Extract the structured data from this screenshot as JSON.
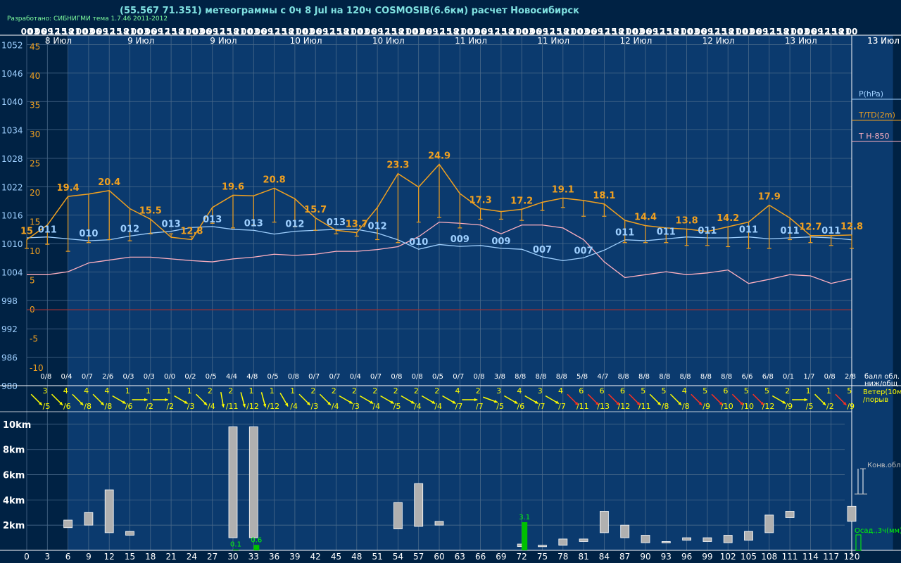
{
  "title": "(55.567 71.351) метеограммы с  0ч 8 Jul на 120ч COSMOSIB(6.6км) расчет Новосибирск",
  "credit": "Разработано: СИБНИГМИ тема 1.7.46 2011-2012",
  "colors": {
    "background": "#002244",
    "band": "#0b3a6e",
    "grid": "#4a6a8a",
    "pressure": "#9fd0ff",
    "temperature": "#f0a020",
    "t850": "#ffb0c0",
    "zero_line": "#a03030",
    "wind_yellow": "#ffff00",
    "wind_red": "#ff3020",
    "cloud_bar": "#b0b0b0",
    "precip": "#00c000",
    "labels": "#ffffff"
  },
  "chart_data": [
    {
      "type": "line",
      "name": "meteogram-upper",
      "top_hours": [
        "00",
        "03",
        "06",
        "09",
        "12",
        "15",
        "18",
        "21",
        "00",
        "03",
        "06",
        "09",
        "12",
        "15",
        "18",
        "21",
        "00",
        "03",
        "06",
        "09",
        "12",
        "15",
        "18",
        "21",
        "00",
        "03",
        "06",
        "09",
        "12",
        "15",
        "18",
        "21",
        "00",
        "03",
        "06",
        "09",
        "12",
        "15",
        "18",
        "21",
        "00",
        "03",
        "06",
        "09",
        "12",
        "15",
        "18",
        "21",
        "00",
        "03",
        "06",
        "09",
        "12",
        "15",
        "18",
        "21",
        "00",
        "03",
        "06",
        "09",
        "12",
        "15",
        "18",
        "21",
        "00",
        "03",
        "06",
        "09",
        "12",
        "15",
        "18",
        "21",
        "00",
        "03",
        "06",
        "09",
        "12",
        "15",
        "18",
        "21",
        "00",
        "03",
        "06",
        "09",
        "12",
        "15",
        "18",
        "21",
        "00",
        "03",
        "06",
        "09",
        "12",
        "15",
        "18",
        "21",
        "00",
        "03",
        "06",
        "09",
        "12",
        "15",
        "18",
        "21",
        "00",
        "03",
        "06",
        "09",
        "12",
        "15",
        "18",
        "21",
        "00",
        "03",
        "06",
        "09",
        "12",
        "15",
        "18",
        "21",
        "00"
      ],
      "date_labels": [
        {
          "h": 0,
          "t": "8 Июл"
        },
        {
          "h": 12,
          "t": "9 Июл"
        },
        {
          "h": 24,
          "t": "9 Июл"
        },
        {
          "h": 36,
          "t": "10 Июл"
        },
        {
          "h": 48,
          "t": "10 Июл"
        },
        {
          "h": 60,
          "t": "11 Июл"
        },
        {
          "h": 72,
          "t": "11 Июл"
        },
        {
          "h": 84,
          "t": "12 Июл"
        },
        {
          "h": 96,
          "t": "12 Июл"
        },
        {
          "h": 108,
          "t": "13 Июл"
        },
        {
          "h": 120,
          "t": "13 Июл"
        }
      ],
      "pressure_axis": {
        "label": "P(hPa)",
        "ticks": [
          1052,
          1046,
          1040,
          1034,
          1028,
          1022,
          1016,
          1010,
          1004,
          998,
          992,
          986,
          980
        ],
        "range": [
          980,
          1054
        ]
      },
      "temperature_axis": {
        "label": "T/TD(2m)",
        "ticks": [
          45,
          40,
          35,
          30,
          25,
          20,
          15,
          10,
          5,
          0,
          -5,
          -10
        ],
        "range": [
          -13,
          47
        ]
      },
      "t850_label": "T H-850",
      "x": [
        0,
        3,
        6,
        9,
        12,
        15,
        18,
        21,
        24,
        27,
        30,
        33,
        36,
        39,
        42,
        45,
        48,
        51,
        54,
        57,
        60,
        63,
        66,
        69,
        72,
        75,
        78,
        81,
        84,
        87,
        90,
        93,
        96,
        99,
        102,
        105,
        108,
        111,
        114,
        117,
        120
      ],
      "series": [
        {
          "name": "P(hPa)",
          "values": [
            1011.2,
            1011.4,
            1011.0,
            1010.6,
            1010.8,
            1011.6,
            1012.2,
            1012.6,
            1013.4,
            1013.6,
            1013.0,
            1012.8,
            1012.0,
            1012.6,
            1012.8,
            1013.0,
            1013.0,
            1012.2,
            1010.8,
            1008.8,
            1009.8,
            1009.4,
            1009.6,
            1009.0,
            1008.8,
            1007.2,
            1006.4,
            1007.0,
            1008.6,
            1010.8,
            1010.6,
            1011.0,
            1011.4,
            1011.2,
            1011.2,
            1011.4,
            1011.0,
            1011.2,
            1011.4,
            1011.2,
            1010.8
          ]
        },
        {
          "name": "T(2m)",
          "values": [
            12.0,
            14.5,
            19.4,
            19.8,
            20.4,
            17.3,
            15.5,
            12.4,
            12.0,
            17.5,
            19.6,
            19.5,
            20.8,
            19.0,
            15.7,
            13.6,
            13.2,
            17.5,
            23.3,
            21.0,
            24.9,
            19.9,
            17.3,
            16.8,
            17.2,
            18.4,
            19.1,
            18.7,
            18.1,
            15.3,
            14.4,
            14.0,
            13.8,
            13.4,
            14.2,
            15.0,
            17.9,
            15.7,
            12.7,
            12.7,
            12.8
          ]
        },
        {
          "name": "TD(2m)",
          "values": [
            10.5,
            11.2,
            10.0,
            11.5,
            12.0,
            11.8,
            13.0,
            13.0,
            12.5,
            14.8,
            14.0,
            14.5,
            15.0,
            14.2,
            13.6,
            13.0,
            12.6,
            12.0,
            11.5,
            15.0,
            15.8,
            14.0,
            15.5,
            15.5,
            15.3,
            17.0,
            17.5,
            16.0,
            16.0,
            11.5,
            11.5,
            11.5,
            11.0,
            11.0,
            10.8,
            10.5,
            10.5,
            12.0,
            11.5,
            11.0,
            10.5
          ]
        },
        {
          "name": "T H-850",
          "values": [
            6.0,
            6.0,
            6.5,
            8.0,
            8.5,
            9.0,
            9.0,
            8.7,
            8.4,
            8.2,
            8.7,
            9.0,
            9.5,
            9.3,
            9.5,
            10.0,
            10.0,
            10.3,
            10.8,
            12.5,
            15.0,
            14.8,
            14.5,
            13.0,
            14.5,
            14.5,
            14.0,
            12.0,
            8.2,
            5.5,
            6.0,
            6.5,
            6.0,
            6.3,
            6.8,
            4.5,
            5.2,
            6.0,
            5.8,
            4.5,
            5.3
          ]
        }
      ],
      "t_labels": [
        {
          "h": 0,
          "t": "15"
        },
        {
          "h": 6,
          "t": "19.4"
        },
        {
          "h": 12,
          "t": "20.4"
        },
        {
          "h": 18,
          "t": "15.5"
        },
        {
          "h": 24,
          "t": "12.8"
        },
        {
          "h": 30,
          "t": "19.6"
        },
        {
          "h": 36,
          "t": "20.8"
        },
        {
          "h": 42,
          "t": "15.7"
        },
        {
          "h": 48,
          "t": "13.7"
        },
        {
          "h": 54,
          "t": "23.3"
        },
        {
          "h": 60,
          "t": "24.9"
        },
        {
          "h": 66,
          "t": "17.3"
        },
        {
          "h": 72,
          "t": "17.2"
        },
        {
          "h": 78,
          "t": "19.1"
        },
        {
          "h": 84,
          "t": "18.1"
        },
        {
          "h": 90,
          "t": "14.4"
        },
        {
          "h": 96,
          "t": "13.8"
        },
        {
          "h": 102,
          "t": "14.2"
        },
        {
          "h": 108,
          "t": "17.9"
        },
        {
          "h": 114,
          "t": "12.7"
        },
        {
          "h": 120,
          "t": "12.8"
        }
      ],
      "p_labels": [
        {
          "h": 3,
          "t": "011"
        },
        {
          "h": 9,
          "t": "010"
        },
        {
          "h": 15,
          "t": "012"
        },
        {
          "h": 21,
          "t": "013"
        },
        {
          "h": 27,
          "t": "013"
        },
        {
          "h": 33,
          "t": "013"
        },
        {
          "h": 39,
          "t": "012"
        },
        {
          "h": 45,
          "t": "013"
        },
        {
          "h": 51,
          "t": "012"
        },
        {
          "h": 57,
          "t": "010"
        },
        {
          "h": 63,
          "t": "009"
        },
        {
          "h": 69,
          "t": "009"
        },
        {
          "h": 75,
          "t": "007"
        },
        {
          "h": 81,
          "t": "007"
        },
        {
          "h": 87,
          "t": "011"
        },
        {
          "h": 93,
          "t": "011"
        },
        {
          "h": 99,
          "t": "011"
        },
        {
          "h": 105,
          "t": "011"
        },
        {
          "h": 111,
          "t": "011"
        },
        {
          "h": 117,
          "t": "011"
        }
      ],
      "cloud_cover": [
        "0/8",
        "0/4",
        "0/7",
        "2/6",
        "0/3",
        "0/3",
        "0/0",
        "0/2",
        "0/5",
        "4/4",
        "4/8",
        "0/5",
        "0/8",
        "0/7",
        "0/7",
        "0/4",
        "0/7",
        "0/8",
        "0/8",
        "0/5",
        "0/7",
        "0/8",
        "3/8",
        "8/8",
        "8/8",
        "8/8",
        "5/8",
        "4/7",
        "8/8",
        "8/8",
        "8/8",
        "8/8",
        "8/8",
        "8/8",
        "6/6",
        "6/8",
        "0/1",
        "1/7",
        "0/8",
        "2/8"
      ],
      "cloud_cover_label": [
        "балл обл.",
        "ниж/общ"
      ]
    },
    {
      "type": "wind",
      "name": "wind-row",
      "label": [
        "Ветер(10м)",
        "/порыв"
      ],
      "speeds": [
        "3",
        "4",
        "4",
        "4",
        "1",
        "1",
        "1",
        "1",
        "2",
        "2",
        "1",
        "1",
        "1",
        "2",
        "2",
        "2",
        "2",
        "2",
        "2",
        "2",
        "4",
        "2",
        "3",
        "4",
        "3",
        "4",
        "6",
        "6",
        "6",
        "5",
        "5",
        "4",
        "5",
        "6",
        "5",
        "5",
        "2",
        "1",
        "1",
        "5"
      ],
      "gusts": [
        "/5",
        "/6",
        "/8",
        "/8",
        "/6",
        "/2",
        "/2",
        "/3",
        "/4",
        "/11",
        "/12",
        "/12",
        "/4",
        "/3",
        "/4",
        "/3",
        "/4",
        "/5",
        "/4",
        "/4",
        "/7",
        "/7",
        "/5",
        "/6",
        "/7",
        "/7",
        "/11",
        "/13",
        "/12",
        "/11",
        "/8",
        "/8",
        "/9",
        "/10",
        "/10",
        "/12",
        "/9",
        "/5",
        "/2",
        "/9"
      ],
      "directions": [
        315,
        315,
        315,
        315,
        300,
        270,
        270,
        300,
        315,
        350,
        345,
        345,
        330,
        315,
        315,
        300,
        300,
        300,
        300,
        300,
        300,
        270,
        290,
        300,
        300,
        300,
        315,
        315,
        315,
        315,
        315,
        315,
        315,
        315,
        315,
        315,
        300,
        270,
        315,
        315
      ],
      "red": [
        false,
        false,
        false,
        false,
        false,
        false,
        false,
        false,
        false,
        false,
        false,
        false,
        false,
        false,
        false,
        false,
        false,
        false,
        false,
        false,
        false,
        false,
        false,
        false,
        false,
        false,
        true,
        true,
        true,
        true,
        false,
        false,
        true,
        true,
        true,
        true,
        false,
        false,
        false,
        true
      ]
    },
    {
      "type": "bar",
      "name": "convective-clouds-precip",
      "axis_ticks": [
        "10km",
        "8km",
        "6km",
        "4km",
        "2km"
      ],
      "axis_range_km": [
        0,
        11
      ],
      "bottom_ticks": [
        "0",
        "3",
        "6",
        "9",
        "12",
        "15",
        "18",
        "21",
        "24",
        "27",
        "30",
        "33",
        "36",
        "39",
        "42",
        "45",
        "48",
        "51",
        "54",
        "57",
        "60",
        "63",
        "66",
        "69",
        "72",
        "75",
        "78",
        "81",
        "84",
        "87",
        "90",
        "93",
        "96",
        "99",
        "102",
        "105",
        "108",
        "111",
        "114",
        "117",
        "120"
      ],
      "conv_label": "Конв.обл.",
      "precip_label": "Осад.,3ч(мм)",
      "clouds": [
        {
          "h": 6,
          "base": 1.8,
          "top": 2.4
        },
        {
          "h": 9,
          "base": 2.0,
          "top": 3.0
        },
        {
          "h": 12,
          "base": 1.4,
          "top": 4.8
        },
        {
          "h": 15,
          "base": 1.2,
          "top": 1.5
        },
        {
          "h": 30,
          "base": 1.0,
          "top": 9.8
        },
        {
          "h": 33,
          "base": 1.0,
          "top": 9.8
        },
        {
          "h": 54,
          "base": 1.7,
          "top": 3.8
        },
        {
          "h": 57,
          "base": 1.9,
          "top": 5.3
        },
        {
          "h": 60,
          "base": 2.0,
          "top": 2.3
        },
        {
          "h": 72,
          "base": 0.3,
          "top": 0.5
        },
        {
          "h": 75,
          "base": 0.3,
          "top": 0.4
        },
        {
          "h": 78,
          "base": 0.4,
          "top": 0.9
        },
        {
          "h": 81,
          "base": 0.7,
          "top": 0.9
        },
        {
          "h": 84,
          "base": 1.4,
          "top": 3.1
        },
        {
          "h": 87,
          "base": 1.0,
          "top": 2.0
        },
        {
          "h": 90,
          "base": 0.6,
          "top": 1.2
        },
        {
          "h": 93,
          "base": 0.6,
          "top": 0.7
        },
        {
          "h": 96,
          "base": 0.8,
          "top": 1.0
        },
        {
          "h": 99,
          "base": 0.7,
          "top": 1.0
        },
        {
          "h": 102,
          "base": 0.6,
          "top": 1.2
        },
        {
          "h": 105,
          "base": 0.8,
          "top": 1.5
        },
        {
          "h": 108,
          "base": 1.4,
          "top": 2.8
        },
        {
          "h": 111,
          "base": 2.6,
          "top": 3.1
        },
        {
          "h": 120,
          "base": 2.3,
          "top": 3.5
        }
      ],
      "precip": [
        {
          "h": 30,
          "v": 0.1,
          "t": "0.1"
        },
        {
          "h": 33,
          "v": 0.6,
          "t": "0.6"
        },
        {
          "h": 72,
          "v": 3.1,
          "t": "3.1"
        }
      ]
    }
  ]
}
